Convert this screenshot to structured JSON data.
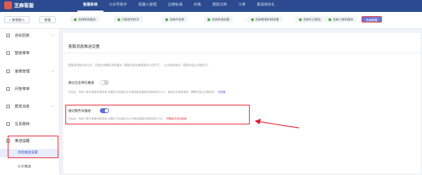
{
  "header": {
    "brand": "芝麻客服",
    "nav": [
      "客服系统",
      "公众号助手",
      "机器人管理",
      "企微私域",
      "价格",
      "帮助文档",
      "工单",
      "邀请有好礼"
    ]
  },
  "toolbar": {
    "add_account": "+ 新增接入",
    "manage": "管理",
    "tabs": [
      "芝麻帮助服务",
      "万能收到你开",
      "芝麻外卖券",
      "芝麻机械流量",
      "芝麻客服机械流量",
      "芝麻生日服务",
      "芝麻二维码服务",
      "芝麻剧集"
    ]
  },
  "sidebar": {
    "items": [
      "自动回复",
      "智能菜单",
      "客服管理",
      "问答菜单",
      "群发消息",
      "互发跳转",
      "推送提醒"
    ],
    "subs": [
      "消息推送设置",
      "公众推送"
    ]
  },
  "main": {
    "title": "客服消息推送设置",
    "desc": "客服消息推送的方式，目前支持模板消息推送（需要对接芝麻客服的小程序号），企业微信推送（需要对接企业微信号）",
    "wecom": {
      "label": "通过企业微信推送",
      "desc": "开启后，有新了新在客服消息系统-设置中开启通过企业微信推送客服消息和到达卡片，使用企业微信推送，需要先接企业微信号。",
      "link": "去配置"
    },
    "mp": {
      "label": "通过服务号推送",
      "desc": "开启后，有新了新在客服消息系统-设置中开启通过公众号推送客服消息和到达卡片。",
      "warn": "付费版才支持使用"
    }
  },
  "colors": {
    "topbar": "#2b4a8f",
    "accent": "#5f6fd6",
    "highlight": "#e22233"
  }
}
